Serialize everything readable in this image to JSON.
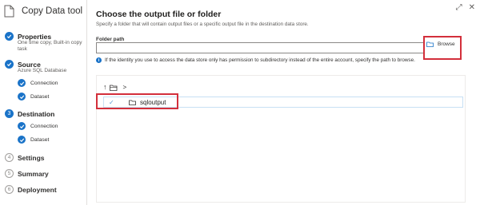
{
  "app": {
    "title": "Copy Data tool"
  },
  "window": {
    "expand_glyph": "⤢",
    "close_glyph": "✕"
  },
  "sidebar": {
    "steps": [
      {
        "title": "Properties",
        "subtitle_lines": [
          "One time copy, Built-in copy",
          "task"
        ],
        "state": "done"
      },
      {
        "title": "Source",
        "subtitle_lines": [
          "Azure SQL Database"
        ],
        "state": "done",
        "substeps": [
          {
            "label": "Connection"
          },
          {
            "label": "Dataset"
          }
        ]
      },
      {
        "title": "Destination",
        "number": "3",
        "state": "current",
        "substeps": [
          {
            "label": "Connection"
          },
          {
            "label": "Dataset"
          }
        ]
      },
      {
        "title": "Settings",
        "number": "4",
        "state": "pending"
      },
      {
        "title": "Summary",
        "number": "5",
        "state": "pending"
      },
      {
        "title": "Deployment",
        "number": "6",
        "state": "pending"
      }
    ]
  },
  "main": {
    "title": "Choose the output file or folder",
    "description": "Specify a folder that will contain output files or a specific output file in the destination data store.",
    "folder_path": {
      "label": "Folder path",
      "value": "",
      "placeholder": ""
    },
    "browse_label": "Browse",
    "info_text": "If the identity you use to access the data store only has permission to subdirectory instead of the entire account, specify the path to browse.",
    "browser": {
      "breadcrumb_separator": ">",
      "items": [
        {
          "name": "sqloutput",
          "selected": true
        }
      ]
    }
  },
  "colors": {
    "accent": "#1a73c8",
    "highlight": "#d32f3b"
  },
  "icons": [
    "app-icon",
    "check-icon",
    "up-arrow-icon",
    "folder-open-icon",
    "folder-icon",
    "info-icon",
    "expand-icon",
    "close-icon"
  ]
}
